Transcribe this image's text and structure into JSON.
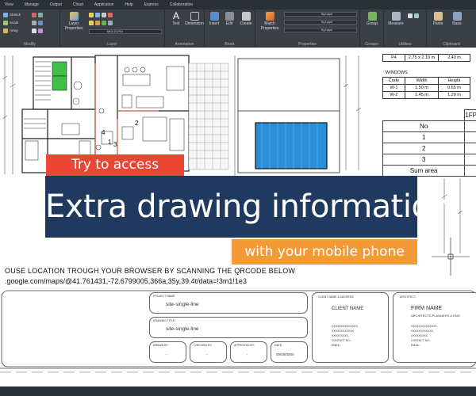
{
  "menu": [
    "View",
    "Manage",
    "Output",
    "Cloud",
    "Application",
    "Help",
    "Express",
    "Collaboration"
  ],
  "ribbon": {
    "groups": [
      {
        "label": "Modify"
      },
      {
        "label": "Layer"
      },
      {
        "label": "Annotation"
      },
      {
        "label": "Block"
      },
      {
        "label": "Properties"
      },
      {
        "label": "Groups"
      },
      {
        "label": "Utilities"
      },
      {
        "label": "Clipboard"
      }
    ],
    "draw_tools": [
      "Stretch",
      "Scale",
      "Array"
    ],
    "layer_properties": "Layer\nProperties",
    "layer_dropdown": "MOLDURA",
    "text": "Text",
    "dimension": "Dimension",
    "insert": "Insert",
    "edit": "Edit",
    "create": "Create",
    "match_properties": "Match\nProperties",
    "byLayer": [
      "ByLayer",
      "ByLayer",
      "ByLayer"
    ],
    "group": "Group",
    "measure": "Measure",
    "paste": "Paste",
    "base": "Base"
  },
  "doors_table": {
    "rows": [
      [
        "P4",
        "2.75 x 2.10 m",
        "2.40 m"
      ]
    ]
  },
  "windows_table": {
    "caption": "WINDOWS",
    "headers": [
      "Code",
      "Width",
      "Height"
    ],
    "rows": [
      [
        "W-1",
        "1.50 m",
        "0.65 m"
      ],
      [
        "W-2",
        "1.45 m",
        "1.20 m"
      ]
    ]
  },
  "area_table": {
    "header": "1FP",
    "col_no": "No",
    "rows": [
      "1",
      "2",
      "3"
    ],
    "sum": "Sum area"
  },
  "banner": {
    "top": "Try to access",
    "main": "Extra drawing information",
    "bottom": "with your mobile phone"
  },
  "qr": {
    "line1": "OUSE LOCATION TROUGH YOUR BROWSER BY SCANNING THE QRCODE BELOW",
    "line2": ".google.com/maps/@41.761431,-72.6799005,366a,35y,39.4t/data=!3m1!1e3"
  },
  "title_block": {
    "project_label": "PROJECT NAME:",
    "project_value": "site-single-line",
    "drawing_label": "DRAWING TITLE:",
    "drawing_value": "site-single-line",
    "drawn_label": "DRAWN BY:",
    "drawn_value": "-",
    "checked_label": "CHECKED BY:",
    "checked_value": "-",
    "approved_label": "APPROVED BY:",
    "approved_value": "-",
    "date_label": "DATE:",
    "date_value": "00/00/0000",
    "client_label": "CLIENT NAME & ADDRESS:",
    "client_name": "CLIENT NAME",
    "client_lines": [
      "XXXXXXXXXXXXXX,",
      "XXXXXXXXXXXX,",
      "XXXXXXXXX.",
      "CONTACT NO:-",
      "EMAIL:"
    ],
    "architect_label": "ARCHITECT:",
    "firm_name": "FIRM NAME",
    "firm_sub": "ARCHITECTS,PLANNERS & ENG",
    "firm_lines": [
      "XXXXXXXXXXXXXX,",
      "XXXXXXXXXXXX,",
      "XXXXXXXXX.",
      "CONTACT NO:-",
      "EMAIL:"
    ]
  },
  "colors": {
    "banner_top": "#ea4633",
    "banner_main": "#1f3a5e",
    "banner_bottom": "#f39a36",
    "ribbon_bg": "#3b3f46",
    "pool_blue": "#2a8fd6"
  }
}
